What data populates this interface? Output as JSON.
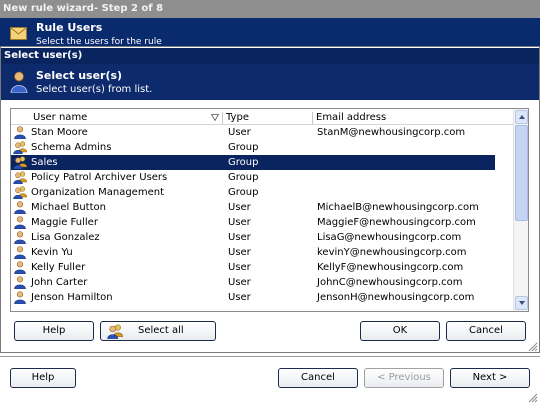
{
  "outer": {
    "title": "New rule wizard- Step 2 of 8",
    "header_title": "Rule Users",
    "header_subtitle": "Select the users for the rule",
    "buttons": {
      "help": "Help",
      "cancel": "Cancel",
      "previous": "< Previous",
      "next": "Next >"
    }
  },
  "dialog": {
    "title": "Select user(s)",
    "header_title": "Select user(s)",
    "header_subtitle": "Select user(s) from list.",
    "columns": {
      "name": "User name",
      "type": "Type",
      "email": "Email address"
    },
    "rows": [
      {
        "name": "Stan Moore",
        "type": "User",
        "email": "StanM@newhousingcorp.com",
        "icon": "user-icon",
        "selected": false
      },
      {
        "name": "Schema Admins",
        "type": "Group",
        "email": "",
        "icon": "group-icon",
        "selected": false
      },
      {
        "name": "Sales",
        "type": "Group",
        "email": "",
        "icon": "group-icon",
        "selected": true
      },
      {
        "name": "Policy Patrol Archiver Users",
        "type": "Group",
        "email": "",
        "icon": "group-icon",
        "selected": false
      },
      {
        "name": "Organization Management",
        "type": "Group",
        "email": "",
        "icon": "group-icon",
        "selected": false
      },
      {
        "name": "Michael Button",
        "type": "User",
        "email": "MichaelB@newhousingcorp.com",
        "icon": "user-icon",
        "selected": false
      },
      {
        "name": "Maggie Fuller",
        "type": "User",
        "email": "MaggieF@newhousingcorp.com",
        "icon": "user-icon",
        "selected": false
      },
      {
        "name": "Lisa Gonzalez",
        "type": "User",
        "email": "LisaG@newhousingcorp.com",
        "icon": "user-icon",
        "selected": false
      },
      {
        "name": "Kevin Yu",
        "type": "User",
        "email": "kevinY@newhousingcorp.com",
        "icon": "user-icon",
        "selected": false
      },
      {
        "name": "Kelly Fuller",
        "type": "User",
        "email": "KellyF@newhousingcorp.com",
        "icon": "user-icon",
        "selected": false
      },
      {
        "name": "John Carter",
        "type": "User",
        "email": "JohnC@newhousingcorp.com",
        "icon": "user-icon",
        "selected": false
      },
      {
        "name": "Jenson Hamilton",
        "type": "User",
        "email": "JensonH@newhousingcorp.com",
        "icon": "user-icon",
        "selected": false
      }
    ],
    "buttons": {
      "help": "Help",
      "select_all": "Select all",
      "ok": "OK",
      "cancel": "Cancel"
    }
  },
  "colors": {
    "header_blue": "#0d2a6c",
    "selection_blue": "#0a2460",
    "title_gray": "#8f8f8f"
  }
}
